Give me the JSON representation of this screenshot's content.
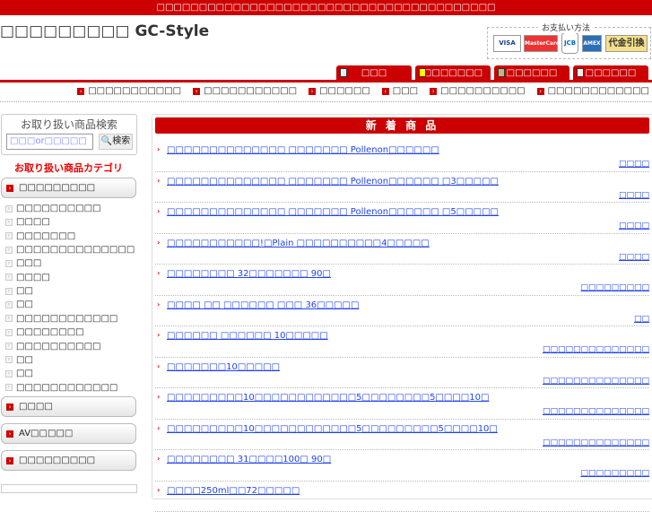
{
  "topbar": "□□□□□□□□□□□□□□□□□□□□□□□□□□□□□□□□□□□□□□□□",
  "site_title": "□□□□□□□□□ GC-Style",
  "payment": {
    "label": "お支払い方法",
    "cards": [
      "VISA",
      "MasterCard",
      "JCB",
      "AMEX",
      "代金引換"
    ]
  },
  "tabs": [
    "□□□",
    "□□□□□□□",
    "□□□□□□",
    "□□□□□□"
  ],
  "subnav": [
    "□□□□□□□□□□□",
    "□□□□□□□□□□□",
    "□□□□□□",
    "□□□",
    "□□□□□□□□□□",
    "□□□□□□□□□□□□"
  ],
  "search": {
    "heading": "お取り扱い商品検索",
    "placeholder": "□□□or□□□□□",
    "button": "検索"
  },
  "category_heading": "お取り扱い商品カテゴリ",
  "categories": {
    "first": "□□□□□□□□□",
    "items": [
      "□□□□□□□□□□",
      "□□□□",
      "□□□□□□□",
      "□□□□□□□□□□□□□□",
      "□□□",
      "□□□□",
      "□□",
      "□□",
      "□□□□□□□□□□□□",
      "□□□□□□□□",
      "□□□□□□□□□□",
      "□□",
      "□□",
      "□□□□□□□□□□□□"
    ],
    "others": [
      "□□□□",
      "AV□□□□□",
      "□□□□□□□□□"
    ]
  },
  "main": {
    "heading": "新 着 商 品",
    "items": [
      {
        "title": "□□□□□□□□□□□□□□ □□□□□□□ Pollenon□□□□□□",
        "cat": "□□□□"
      },
      {
        "title": "□□□□□□□□□□□□□□ □□□□□□□ Pollenon□□□□□□ □3□□□□□",
        "cat": "□□□□"
      },
      {
        "title": "□□□□□□□□□□□□□□ □□□□□□□ Pollenon□□□□□□ □5□□□□□",
        "cat": "□□□□"
      },
      {
        "title": "□□□□□□□□□□□!□Plain □□□□□□□□□□4□□□□□",
        "cat": "□□□□"
      },
      {
        "title": "□□□□□□□□ 32□□□□□□□ 90□",
        "cat": "□□□□□□□□□"
      },
      {
        "title": "□□□□ □□ □□□□□□ □□□ 36□□□□□",
        "cat": "□□"
      },
      {
        "title": "□□□□□□ □□□□□□ 10□□□□□",
        "cat": "□□□□□□□□□□□□□□"
      },
      {
        "title": "□□□□□□□10□□□□□",
        "cat": "□□□□□□□□□□□□□□"
      },
      {
        "title": "□□□□□□□□□10□□□□□□□□□□□□5□□□□□□□□5□□□□10□",
        "cat": "□□□□□□□□□□□□□□"
      },
      {
        "title": "□□□□□□□□□10□□□□□□□□□□□□5□□□□□□□□□5□□□□10□",
        "cat": "□□□□□□□□□□□□□□"
      },
      {
        "title": "□□□□□□□□ 31□□□□100□ 90□",
        "cat": "□□□□□□□□□"
      },
      {
        "title": "□□□□250ml□□72□□□□□",
        "cat": ""
      }
    ]
  }
}
